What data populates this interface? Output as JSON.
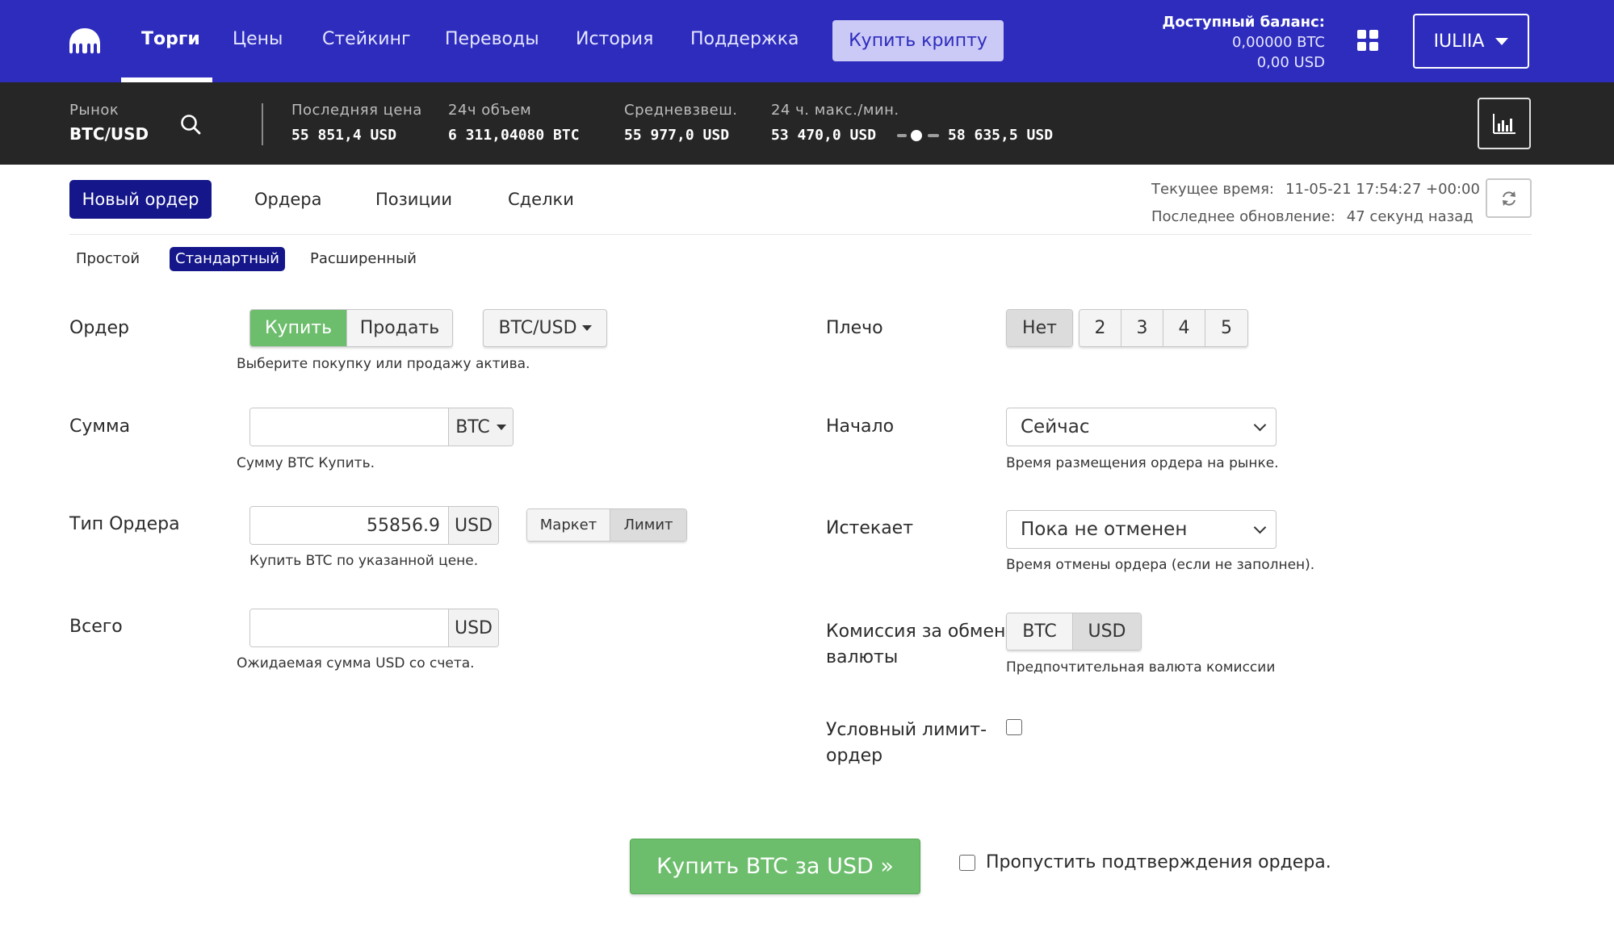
{
  "nav": {
    "items": [
      "Торги",
      "Цены",
      "Стейкинг",
      "Переводы",
      "История",
      "Поддержка"
    ],
    "active_index": 0,
    "buy_crypto": "Купить крипту",
    "balance_title": "Доступный баланс:",
    "balance_btc": "0,00000 BTC",
    "balance_usd": "0,00 USD",
    "user": "IULIIA",
    "logo_icon": "kraken-logo-icon",
    "apps_icon": "grid-icon"
  },
  "market": {
    "label": "Рынок",
    "pair": "BTC/USD",
    "last_price_label": "Последняя цена",
    "last_price": "55 851,4 USD",
    "volume_label": "24ч объем",
    "volume": "6 311,04080 BTC",
    "vwap_label": "Средневзвеш.",
    "vwap": "55 977,0 USD",
    "hilo_label": "24 ч. макс./мин.",
    "low": "53 470,0 USD",
    "high": "58 635,5 USD"
  },
  "tabs": {
    "new_order": "Новый ордер",
    "orders": "Ордера",
    "positions": "Позиции",
    "trades": "Сделки"
  },
  "time": {
    "current_label": "Текущее время:",
    "current_value": "11-05-21 17:54:27 +00:00",
    "updated_label": "Последнее обновление:",
    "updated_value": "47 секунд назад"
  },
  "subtabs": {
    "simple": "Простой",
    "standard": "Стандартный",
    "advanced": "Расширенный"
  },
  "form": {
    "order_label": "Ордер",
    "buy": "Купить",
    "sell": "Продать",
    "pair_select": "BTC/USD",
    "order_hint": "Выберите покупку или продажу актива.",
    "amount_label": "Сумма",
    "amount_value": "",
    "amount_currency": "BTC",
    "amount_hint": "Сумму BTC Купить.",
    "type_label": "Тип Ордера",
    "price_value": "55856.9",
    "price_currency": "USD",
    "market": "Маркет",
    "limit": "Лимит",
    "type_hint": "Купить BTC по указанной цене.",
    "total_label": "Всего",
    "total_value": "",
    "total_currency": "USD",
    "total_hint": "Ожидаемая сумма USD со счета.",
    "leverage_label": "Плечо",
    "leverage_none": "Нет",
    "leverage_options": [
      "2",
      "3",
      "4",
      "5"
    ],
    "start_label": "Начало",
    "start_value": "Сейчас",
    "start_hint": "Время размещения ордера на рынке.",
    "expires_label": "Истекает",
    "expires_value": "Пока не отменен",
    "expires_hint": "Время отмены ордера (если не заполнен).",
    "fee_label_1": "Комиссия за обмен",
    "fee_label_2": "валюты",
    "fee_btc": "BTC",
    "fee_usd": "USD",
    "fee_hint": "Предпочтительная валюта комиссии",
    "cond_label_1": "Условный лимит-",
    "cond_label_2": "ордер",
    "submit": "Купить BTC за USD »",
    "skip_confirm": "Пропустить подтверждения ордера."
  },
  "colors": {
    "nav_bg": "#2d2cbd",
    "market_bg": "#262626",
    "accent_dark": "#14168a",
    "buy_green": "#6cbd6c"
  }
}
